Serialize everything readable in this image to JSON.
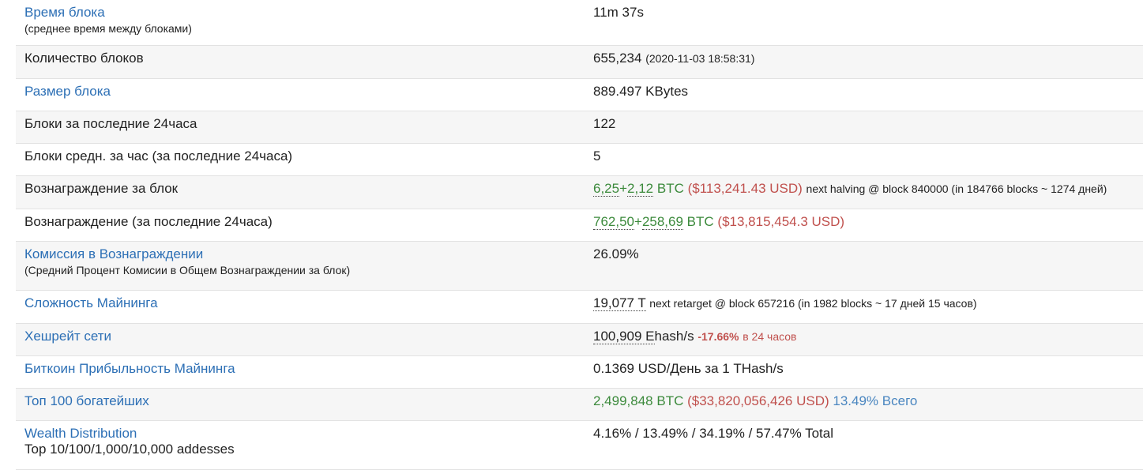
{
  "rows": [
    {
      "label": "Время блока",
      "sub": "(среднее время между блоками)",
      "value": "11m 37s"
    },
    {
      "label": "Количество блоков",
      "value": "655,234",
      "value_extra": "(2020-11-03 18:58:31)"
    },
    {
      "label": "Размер блока",
      "value": "889.497 KBytes"
    },
    {
      "label": "Блоки за последние 24часа",
      "value": "122"
    },
    {
      "label": "Блоки средн. за час (за последние 24часа)",
      "value": "5"
    },
    {
      "label": "Вознаграждение за блок",
      "reward_a": "6,25",
      "reward_plus": "+",
      "reward_b": "2,12",
      "currency": "BTC",
      "usd": "($113,241.43 USD)",
      "extra": "next halving @ block 840000 (in 184766 blocks ~ 1274 дней)"
    },
    {
      "label": "Вознаграждение (за последние 24часа)",
      "reward_a": "762,50",
      "reward_plus": "+",
      "reward_b": "258,69",
      "currency": "BTC",
      "usd": "($13,815,454.3 USD)"
    },
    {
      "label": "Комиссия в Вознаграждении",
      "sub": "(Средний Процент Комисии в Общем Вознаграждении за блок)",
      "value": "26.09%"
    },
    {
      "label": "Сложность Майнинга",
      "value": "19,077 T",
      "extra": "next retarget @ block 657216 (in 1982 blocks ~ 17 дней 15 часов)"
    },
    {
      "label": "Хешрейт сети",
      "value_num": "100,909 E",
      "value_unit": "hash/s",
      "change": "-17.66%",
      "change_suffix": "в 24 часов"
    },
    {
      "label": "Биткоин Прибыльность Майнинга",
      "value": "0.1369 USD/День за 1 THash/s"
    },
    {
      "label": "Топ 100 богатейших",
      "btc": "2,499,848 BTC",
      "usd": "($33,820,056,426 USD)",
      "share": "13.49% Всего"
    },
    {
      "label": "Wealth Distribution",
      "sub": "Top 10/100/1,000/10,000 addesses",
      "value": "4.16% / 13.49% / 34.19% / 57.47% Total"
    }
  ],
  "colors": {
    "link": "#2c6fb5",
    "green": "#3c8a3c",
    "red": "#c0504d",
    "blue": "#4a86c0",
    "stripe": "#f6f6f6"
  }
}
